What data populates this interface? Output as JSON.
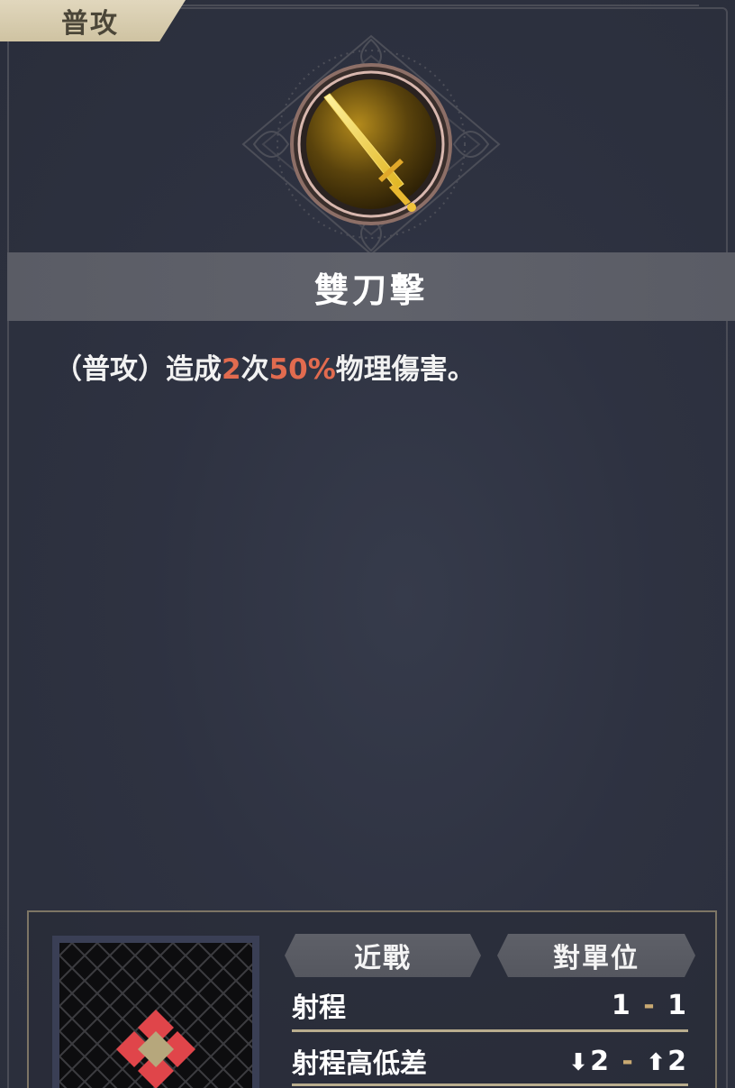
{
  "category_tab": "普攻",
  "skill": {
    "icon": "sword-icon",
    "name": "雙刀擊",
    "description": {
      "prefix": "（普攻）造成",
      "hits": "2",
      "mid": "次",
      "percent": "50%",
      "suffix": "物理傷害。"
    }
  },
  "tags": {
    "attack_type": "近戰",
    "target": "對單位"
  },
  "stats": {
    "range_label": "射程",
    "range_min": "1",
    "range_sep": "-",
    "range_max": "1",
    "height_label": "射程高低差",
    "height_down": "2",
    "height_sep": "-",
    "height_up": "2"
  },
  "colors": {
    "highlight": "#e26b4f",
    "tab_bg": "#d8cdb0",
    "panel_bg": "#2e3241",
    "range_cell": "#e0454a",
    "center_cell": "#b6a77c"
  }
}
